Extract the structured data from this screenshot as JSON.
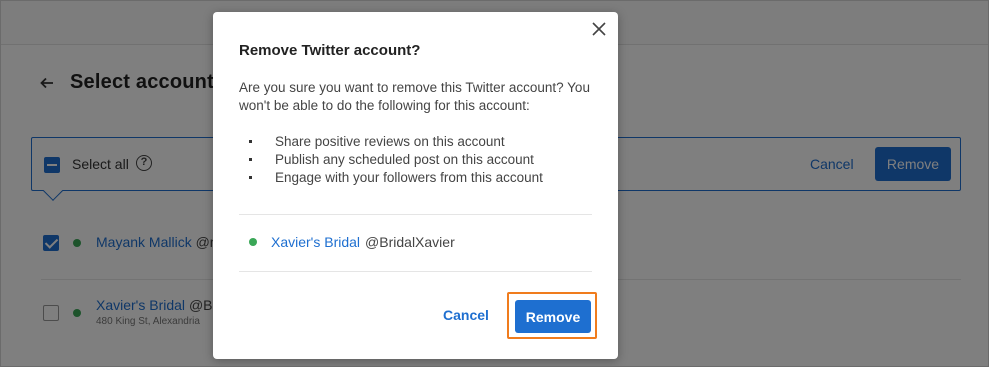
{
  "page": {
    "title": "Select accounts",
    "select_all_label": "Select all",
    "cancel_label": "Cancel",
    "remove_label": "Remove",
    "accounts": [
      {
        "name": "Mayank Mallick",
        "handle": "@m",
        "address": "",
        "checked": true
      },
      {
        "name": "Xavier's Bridal",
        "handle": "@Bri",
        "address": "480 King St, Alexandria",
        "checked": false
      }
    ]
  },
  "modal": {
    "title": "Remove Twitter account?",
    "body": "Are you sure you want to remove this Twitter account? You won't be able to do the following for this account:",
    "bullets": [
      "Share positive reviews on this account",
      "Publish any scheduled post on this account",
      "Engage with your followers from this account"
    ],
    "account": {
      "name": "Xavier's Bridal",
      "handle": "@BridalXavier"
    },
    "cancel_label": "Cancel",
    "remove_label": "Remove"
  },
  "colors": {
    "accent": "#1e6fd0",
    "status_dot": "#3aa757",
    "highlight": "#f07c1d"
  },
  "icons": {
    "back": "arrow-left-icon",
    "help": "question-circle-icon",
    "close": "close-icon"
  }
}
